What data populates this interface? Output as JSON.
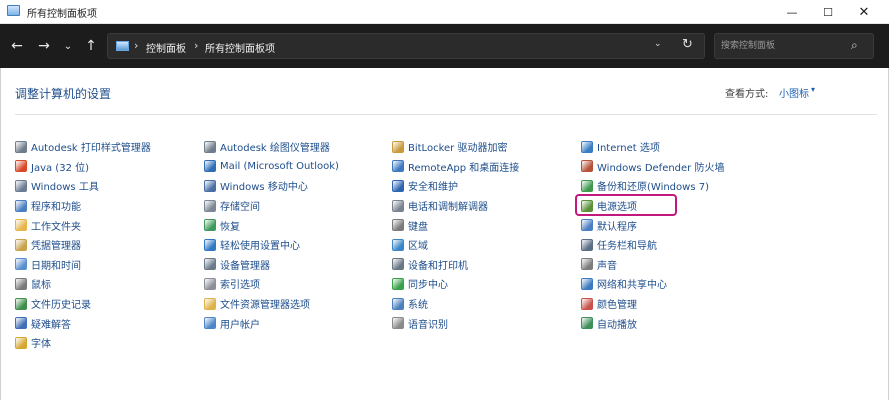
{
  "window": {
    "title": "所有控制面板项",
    "minimize": "—",
    "maximize": "☐",
    "close": "✕"
  },
  "nav": {
    "back": "←",
    "forward": "→",
    "recent": "⌄",
    "up": "↑",
    "breadcrumbs": [
      "控制面板",
      "所有控制面板项"
    ],
    "separator": "›",
    "dropdown": "⌄",
    "refresh": "↻",
    "search_placeholder": "搜索控制面板",
    "search_icon": "⌕"
  },
  "main": {
    "heading": "调整计算机的设置",
    "view_by_label": "查看方式:",
    "view_by_value": "小图标",
    "view_by_caret": "▾",
    "highlighted_item": "电源选项",
    "columns": [
      [
        {
          "label": "Autodesk 打印样式管理器",
          "icon": "printer-icon",
          "color": "#6f7d8c"
        },
        {
          "label": "Java (32 位)",
          "icon": "java-icon",
          "color": "#d9482b"
        },
        {
          "label": "Windows 工具",
          "icon": "windows-tools-icon",
          "color": "#6b7c93"
        },
        {
          "label": "程序和功能",
          "icon": "programs-icon",
          "color": "#4a7fc1"
        },
        {
          "label": "工作文件夹",
          "icon": "folder-icon",
          "color": "#e7b54a"
        },
        {
          "label": "凭据管理器",
          "icon": "credential-icon",
          "color": "#c9a24a"
        },
        {
          "label": "日期和时间",
          "icon": "clock-icon",
          "color": "#5a8fcf"
        },
        {
          "label": "鼠标",
          "icon": "mouse-icon",
          "color": "#7a7a7a"
        },
        {
          "label": "文件历史记录",
          "icon": "file-history-icon",
          "color": "#3d8f4a"
        },
        {
          "label": "疑难解答",
          "icon": "troubleshoot-icon",
          "color": "#3f6fb5"
        },
        {
          "label": "字体",
          "icon": "font-icon",
          "color": "#d6a730"
        }
      ],
      [
        {
          "label": "Autodesk 绘图仪管理器",
          "icon": "plotter-icon",
          "color": "#6f7d8c"
        },
        {
          "label": "Mail (Microsoft Outlook)",
          "icon": "mail-icon",
          "color": "#2f6db5"
        },
        {
          "label": "Windows 移动中心",
          "icon": "mobility-icon",
          "color": "#4a6fa5"
        },
        {
          "label": "存储空间",
          "icon": "storage-icon",
          "color": "#7b8794"
        },
        {
          "label": "恢复",
          "icon": "recovery-icon",
          "color": "#3d9a5b"
        },
        {
          "label": "轻松使用设置中心",
          "icon": "ease-of-access-icon",
          "color": "#2f78c4"
        },
        {
          "label": "设备管理器",
          "icon": "device-manager-icon",
          "color": "#6a7a8a"
        },
        {
          "label": "索引选项",
          "icon": "indexing-icon",
          "color": "#8a8f99"
        },
        {
          "label": "文件资源管理器选项",
          "icon": "folder-options-icon",
          "color": "#e0b24a"
        },
        {
          "label": "用户帐户",
          "icon": "user-accounts-icon",
          "color": "#4c86c6"
        }
      ],
      [
        {
          "label": "BitLocker 驱动器加密",
          "icon": "bitlocker-icon",
          "color": "#c89a3a"
        },
        {
          "label": "RemoteApp 和桌面连接",
          "icon": "remoteapp-icon",
          "color": "#3e78c0"
        },
        {
          "label": "安全和维护",
          "icon": "flag-icon",
          "color": "#2f65b0"
        },
        {
          "label": "电话和调制解调器",
          "icon": "phone-modem-icon",
          "color": "#7a8491"
        },
        {
          "label": "键盘",
          "icon": "keyboard-icon",
          "color": "#7b7b7b"
        },
        {
          "label": "区域",
          "icon": "region-icon",
          "color": "#3a86c8"
        },
        {
          "label": "设备和打印机",
          "icon": "devices-printers-icon",
          "color": "#6a7684"
        },
        {
          "label": "同步中心",
          "icon": "sync-icon",
          "color": "#3aa04a"
        },
        {
          "label": "系统",
          "icon": "system-icon",
          "color": "#4c7fbd"
        },
        {
          "label": "语音识别",
          "icon": "microphone-icon",
          "color": "#8a8a8a"
        }
      ],
      [
        {
          "label": "Internet 选项",
          "icon": "internet-options-icon",
          "color": "#3a7dc4"
        },
        {
          "label": "Windows Defender 防火墙",
          "icon": "firewall-icon",
          "color": "#b5533a"
        },
        {
          "label": "备份和还原(Windows 7)",
          "icon": "backup-icon",
          "color": "#3f9a4f"
        },
        {
          "label": "电源选项",
          "icon": "power-options-icon",
          "color": "#5b8f3a"
        },
        {
          "label": "默认程序",
          "icon": "default-programs-icon",
          "color": "#4a7fc1"
        },
        {
          "label": "任务栏和导航",
          "icon": "taskbar-icon",
          "color": "#5a6e86"
        },
        {
          "label": "声音",
          "icon": "sound-icon",
          "color": "#7d7d7d"
        },
        {
          "label": "网络和共享中心",
          "icon": "network-icon",
          "color": "#3b7bbf"
        },
        {
          "label": "颜色管理",
          "icon": "color-management-icon",
          "color": "#c7534a"
        },
        {
          "label": "自动播放",
          "icon": "autoplay-icon",
          "color": "#3e8f5a"
        }
      ]
    ]
  }
}
